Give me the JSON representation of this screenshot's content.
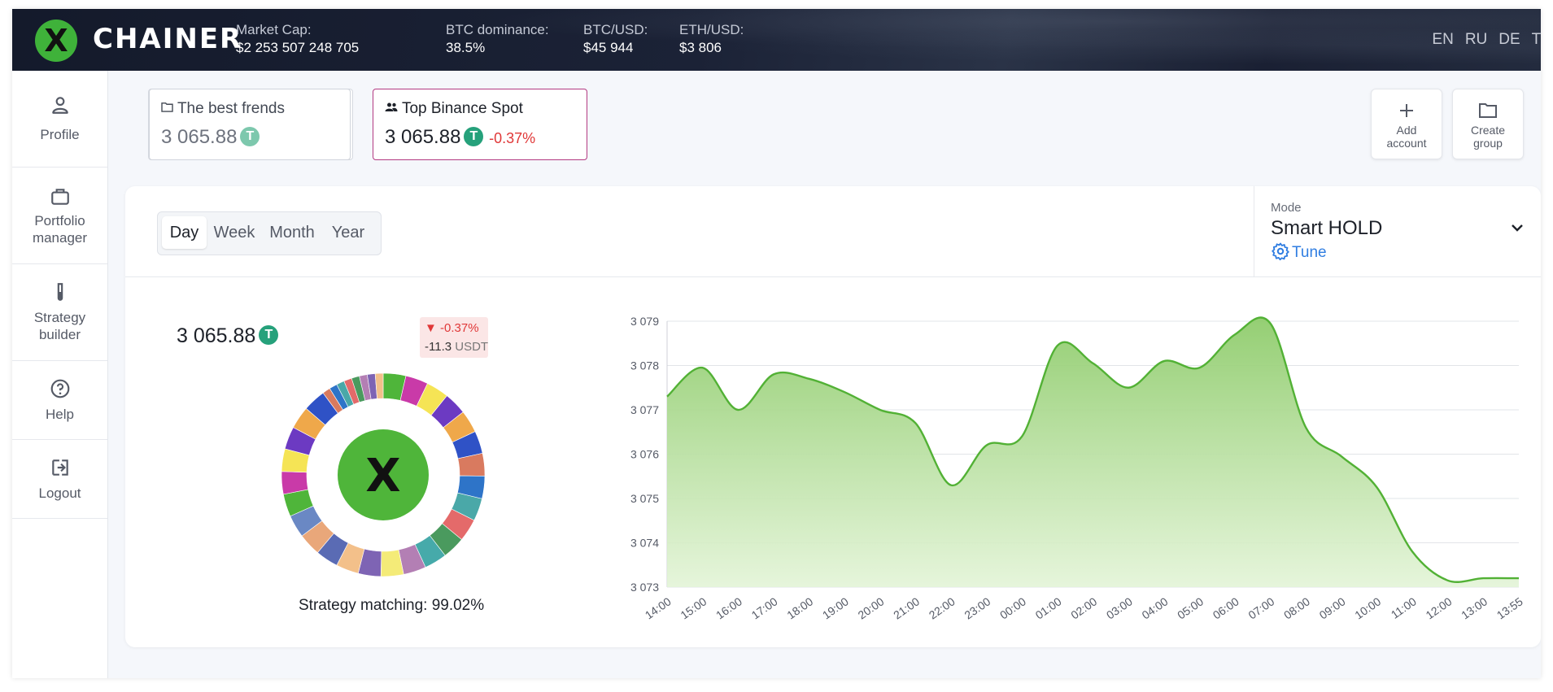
{
  "brand": {
    "logo_letter": "X",
    "name": "CHAINER"
  },
  "header": {
    "stats": [
      {
        "label": "Market Cap:",
        "value": "$2 253 507 248 705"
      },
      {
        "label": "BTC dominance:",
        "value": "38.5%"
      },
      {
        "label": "BTC/USD:",
        "value": "$45 944"
      },
      {
        "label": "ETH/USD:",
        "value": "$3 806"
      }
    ],
    "languages": [
      "EN",
      "RU",
      "DE",
      "TR"
    ]
  },
  "sidebar": {
    "items": [
      {
        "label": "Profile",
        "icon": "person-icon"
      },
      {
        "label": "Portfolio manager",
        "icon": "briefcase-icon"
      },
      {
        "label": "Strategy builder",
        "icon": "flask-icon"
      },
      {
        "label": "Help",
        "icon": "question-icon"
      },
      {
        "label": "Logout",
        "icon": "logout-icon"
      }
    ]
  },
  "accounts": [
    {
      "name": "The best frends",
      "value": "3 065.88",
      "currency_icon": "tether-icon",
      "icon": "folder-icon"
    },
    {
      "name": "Top Binance Spot",
      "value": "3 065.88",
      "currency_icon": "tether-icon",
      "change": "-0.37%",
      "icon": "users-icon",
      "selected": true
    }
  ],
  "actions": {
    "add_account": "Add account",
    "create_group": "Create group"
  },
  "periods": {
    "options": [
      "Day",
      "Week",
      "Month",
      "Year"
    ],
    "selected": "Day"
  },
  "mode": {
    "label": "Mode",
    "value": "Smart HOLD",
    "tune": "Tune"
  },
  "portfolio": {
    "total": "3 065.88",
    "change_pct": "▼ -0.37%",
    "change_abs": "-11.3",
    "change_unit": "USDT",
    "center_logo": "X",
    "strategy_matching": "Strategy matching: 99.02%",
    "donut_colors": [
      "#4fb53a",
      "#c93aa8",
      "#f5e455",
      "#6c3ac2",
      "#efa84a",
      "#2f52c6",
      "#d97a5f",
      "#2e74c8",
      "#4aa8a8",
      "#e46a6a",
      "#4a9a5e",
      "#46aaaa",
      "#b37fb4",
      "#f4eb78",
      "#7e64b4",
      "#f3c08a",
      "#5a6bb4",
      "#e9a77a",
      "#6a88c4",
      "#4fb53a",
      "#c93aa8",
      "#f5e455",
      "#6c3ac2",
      "#efa84a",
      "#2f52c6",
      "#d97a5f",
      "#2e74c8",
      "#4aa8a8",
      "#e46a6a",
      "#4a9a5e",
      "#b37fb4",
      "#7e64b4",
      "#f3c08a"
    ]
  },
  "chart_data": {
    "type": "area",
    "x": [
      "14:00",
      "15:00",
      "16:00",
      "17:00",
      "18:00",
      "19:00",
      "20:00",
      "21:00",
      "22:00",
      "23:00",
      "00:00",
      "01:00",
      "02:00",
      "03:00",
      "04:00",
      "05:00",
      "06:00",
      "07:00",
      "08:00",
      "09:00",
      "10:00",
      "11:00",
      "12:00",
      "13:00",
      "13:55"
    ],
    "y": [
      3077.3,
      3077.95,
      3077.0,
      3077.8,
      3077.7,
      3077.4,
      3077.0,
      3076.7,
      3075.3,
      3076.2,
      3076.4,
      3078.45,
      3078.05,
      3077.5,
      3078.1,
      3077.95,
      3078.7,
      3078.95,
      3076.6,
      3075.95,
      3075.25,
      3073.8,
      3073.15,
      3073.2,
      3073.2
    ],
    "ylim": [
      3073,
      3079
    ],
    "yticks": [
      "3 073",
      "3 074",
      "3 075",
      "3 076",
      "3 077",
      "3 078",
      "3 079"
    ],
    "line_color": "#52b135",
    "grid": true
  }
}
